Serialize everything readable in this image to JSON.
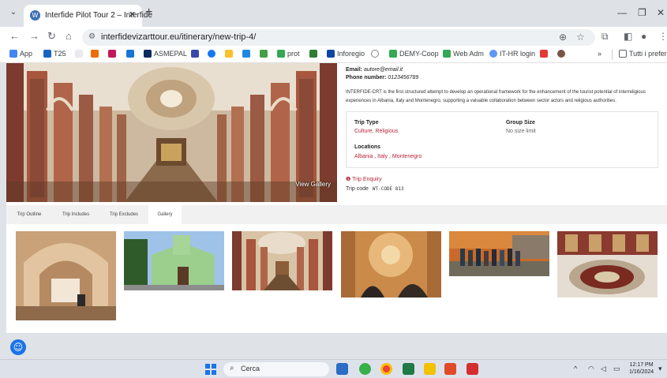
{
  "browser": {
    "tab_title": "Interfide Pilot Tour 2 – Interfide",
    "url": "interfidevizarttour.eu/itinerary/new-trip-4/",
    "bookmarks": [
      "App",
      "T25",
      "ASMEPAL",
      "prot",
      "Inforegio",
      "DEMY-Coop",
      "Web Adm",
      "IT-HR login"
    ],
    "all_bookmarks_label": "Tutti i preferiti"
  },
  "trip": {
    "email_label": "Email:",
    "email": "autore@email.it",
    "phone_label": "Phone number:",
    "phone": "0123456789",
    "description": "INTERFIDE-CRT is the first structured attempt to develop an operational framework for the enhancement of the tourist potential of interreligious experiences in Albania, Italy and Montenegro, supporting a valuable collaboration between sector actors and religious authorities.",
    "trip_type_label": "Trip Type",
    "trip_type_value": "Culture, Religious",
    "group_size_label": "Group Size",
    "group_size_value": "No size limit",
    "locations_label": "Locations",
    "locations_value": "Albania , Italy , Montenegro",
    "enquiry_label": "Trip Enquiry",
    "trip_code_label": "Trip code",
    "trip_code_value": "WT-CODE 813",
    "view_gallery_label": "View Gallery"
  },
  "page_tabs": [
    "Trip Outline",
    "Trip Includes",
    "Trip Excludes",
    "Gallery"
  ],
  "active_tab": "Gallery",
  "taskbar": {
    "search_placeholder": "Cerca",
    "time": "12:17 PM",
    "date": "1/16/2024"
  },
  "colors": {
    "accent": "#b4243a",
    "brand_blue": "#1a73e8"
  }
}
